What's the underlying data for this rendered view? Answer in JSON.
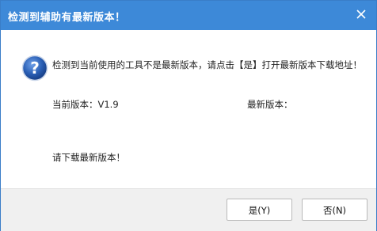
{
  "dialog": {
    "title": "检测到辅助有最新版本！",
    "message": "检测到当前使用的工具不是最新版本，请点击【是】打开最新版本下载地址！",
    "current_version_label": "当前版本：V1.9",
    "latest_version_label": "最新版本：",
    "download_prompt": "请下载最新版本！",
    "yes_button": "是(Y)",
    "no_button": "否(N)",
    "close_icon": "close-icon",
    "message_icon": "question-icon"
  },
  "colors": {
    "titlebar": "#3d89d8",
    "footer": "#f0f0f0",
    "icon_blue": "#2a5fb5"
  }
}
